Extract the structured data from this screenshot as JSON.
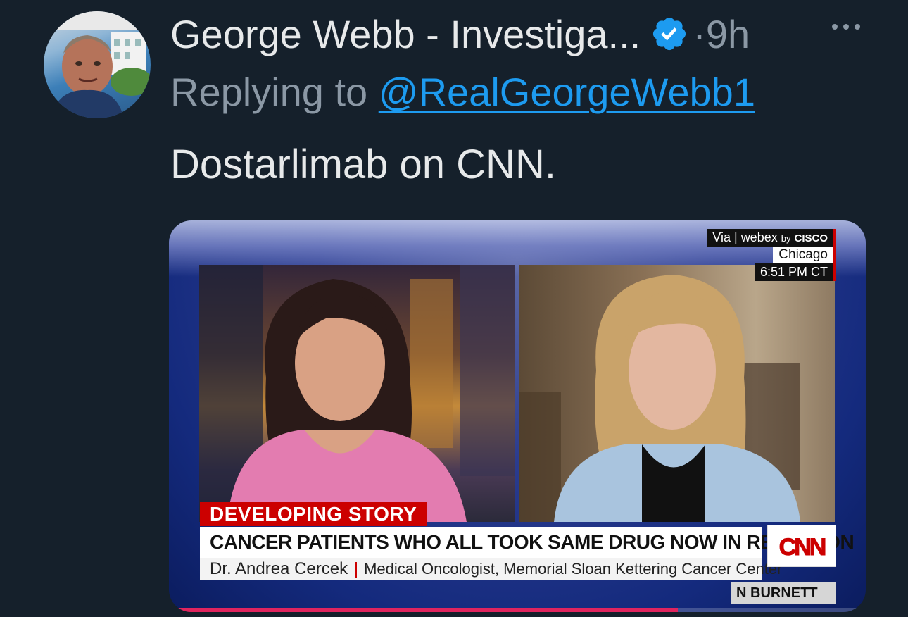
{
  "tweet": {
    "display_name": "George Webb - Investiga...",
    "time": "9h",
    "reply_prefix": "Replying to",
    "reply_handle": "@RealGeorgeWebb1",
    "text": "Dostarlimab on CNN."
  },
  "icons": {
    "verified": "verified-badge-icon",
    "more": "more-options-icon"
  },
  "colors": {
    "background": "#15202b",
    "primary_text": "#e7e9ea",
    "secondary_text": "#8b98a5",
    "link": "#1d9bf0",
    "cnn_red": "#cc0000"
  },
  "media": {
    "bug_via_prefix": "Via",
    "bug_via_brand": "webex",
    "bug_via_by": "by",
    "bug_via_company": "CISCO",
    "location": "Chicago",
    "clock": "6:51 PM CT",
    "tag": "DEVELOPING STORY",
    "headline": "CANCER PATIENTS WHO ALL TOOK SAME DRUG NOW IN REMISSION",
    "guest_name": "Dr. Andrea Cercek",
    "guest_title": "Medical Oncologist, Memorial Sloan Kettering Cancer Center",
    "network": "CNN",
    "show": "N BURNETT",
    "progress": 0.73
  }
}
